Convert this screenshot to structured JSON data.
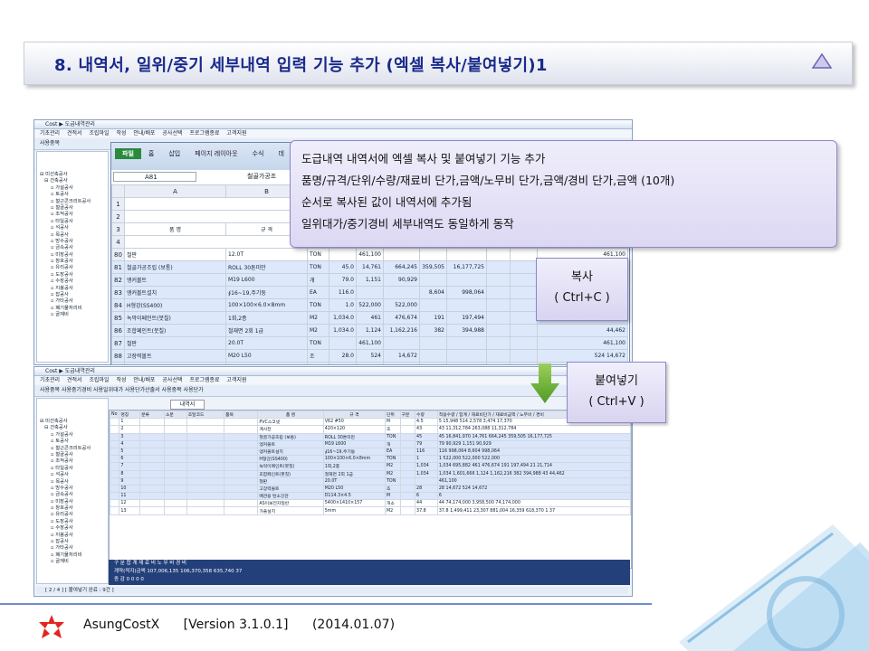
{
  "banner": {
    "title": "8. 내역서, 일위/중기 세부내역 입력 기능 추가 (엑셀 복사/붙여넣기)1"
  },
  "callout": {
    "lines": [
      "도급내역 내역서에 엑셀 복사 및 붙여넣기 기능 추가",
      "품명/규격/단위/수량/재료비 단가,금액/노무비 단가,금액/경비 단가,금액 (10개)",
      "순서로 복사된 값이 내역서에 추가됨",
      "일위대가/중기경비 세부내역도 동일하게 동작"
    ]
  },
  "copy_box": {
    "title": "복사",
    "shortcut": "( Ctrl+C )"
  },
  "paste_box": {
    "title": "붙여넣기",
    "shortcut": "( Ctrl+V )"
  },
  "win1": {
    "title": "Cost ▶ 도급내역관리",
    "menu": "기초관리 견적서 조립마일 작성 안내/배포 공사선택 프로그램종료 고객지원",
    "toolbar": "사용중목",
    "unit": "A81",
    "formula": "철골가공조",
    "ribbon_tabs": [
      "파일",
      "홈",
      "삽입",
      "페이지 레이아웃",
      "수식",
      "데"
    ],
    "col_a": "A",
    "col_b": "B",
    "header_name": "품       명",
    "header_spec": "규       격",
    "tree": [
      "미선축공사",
      "건축공사",
      "가설공사",
      "토공사",
      "철근콘크리트공사",
      "철골공사",
      "조적공사",
      "타일공사",
      "석공사",
      "목공사",
      "방수공사",
      "금속공사",
      "미장공사",
      "창호공사",
      "유리공사",
      "도장공사",
      "수장공사",
      "지붕공사",
      "잡공사",
      "가타공사",
      "폐기물처리비",
      "골재비"
    ],
    "rows": [
      {
        "no": "80",
        "name": "철판",
        "spec": "12.0T",
        "unit": "TON",
        "c1": "",
        "c2": "461,100",
        "c3": "",
        "c4": "",
        "c5": "",
        "r": "461,100",
        "sel": false
      },
      {
        "no": "81",
        "name": "철골가공조립 (보통)",
        "spec": "ROLL 30톤미만",
        "unit": "TON",
        "c1": "45.0",
        "c2": "14,761",
        "c3": "664,245",
        "c4": "359,505",
        "c5": "16,177,725",
        "r": "374,",
        "sel": true
      },
      {
        "no": "82",
        "name": "앵커볼트",
        "spec": "M19  L600",
        "unit": "개",
        "c1": "79.0",
        "c2": "1,151",
        "c3": "90,929",
        "c4": "",
        "c5": "",
        "r": "1,",
        "sel": true
      },
      {
        "no": "83",
        "name": "앵커볼트설치",
        "spec": "∮16~19,주기둥",
        "unit": "EA",
        "c1": "116.0",
        "c2": "",
        "c3": "",
        "c4": "8,604",
        "c5": "998,064",
        "r": "8,",
        "sel": true
      },
      {
        "no": "84",
        "name": "H형강(SS400)",
        "spec": "100×100×6.0×8mm",
        "unit": "TON",
        "c1": "1.0",
        "c2": "522,000",
        "c3": "522,000",
        "c4": "",
        "c5": "",
        "r": "522,",
        "sel": true
      },
      {
        "no": "85",
        "name": "녹막이페인트(붓칠)",
        "spec": "1회,2종",
        "unit": "M2",
        "c1": "1,034.0",
        "c2": "461",
        "c3": "476,674",
        "c4": "191",
        "c5": "197,494",
        "r": "21,714",
        "sel": true
      },
      {
        "no": "86",
        "name": "조합페인트(붓칠)",
        "spec": "철재면 2회 1급",
        "unit": "M2",
        "c1": "1,034.0",
        "c2": "1,124",
        "c3": "1,162,216",
        "c4": "382",
        "c5": "394,988",
        "r": "44,462",
        "sel": true
      },
      {
        "no": "87",
        "name": "철판",
        "spec": "20.0T",
        "unit": "TON",
        "c1": "",
        "c2": "461,100",
        "c3": "",
        "c4": "",
        "c5": "",
        "r": "461,100",
        "sel": true
      },
      {
        "no": "88",
        "name": "고장력볼트",
        "spec": "M20  L50",
        "unit": "조",
        "c1": "28.0",
        "c2": "524",
        "c3": "14,672",
        "c4": "",
        "c5": "",
        "r": "524  14,672",
        "sel": true
      },
      {
        "no": "89",
        "name": "배관용 탄소강관",
        "spec": "D114.3×4.5",
        "unit": "M",
        "c1": "6.0",
        "c2": "",
        "c3": "",
        "c4": "",
        "c5": "",
        "r": "",
        "sel": true
      },
      {
        "no": "90",
        "name": "H형강(SS400)",
        "spec": "300×150×6.5×9mm",
        "unit": "TON",
        "c1": "2.0",
        "c2": "522,000",
        "c3": "1,044,000",
        "c4": "",
        "c5": "",
        "r": "522,000  1,044,000",
        "sel": false
      }
    ]
  },
  "win2": {
    "title": "Cost ▶ 도급내역관리",
    "menu": "기초관리 견적서 조립마일 작성 안내/배포 공사선택 프로그램종료 고객지원",
    "toolbar": "사용중목   사용중기경비   사용일위대가   사용단가산출서   사용중목   사용단가",
    "tab_label": "내역서",
    "headers": [
      "No",
      "명칭",
      "분류",
      "소분",
      "조달코드",
      "품목",
      "품  명",
      "규  격",
      "단위",
      "구분",
      "수량",
      "적용수량",
      "합  계",
      "재료비단가",
      "재료비금액",
      "노무비단가",
      "노무비금액",
      "경비단가",
      "경비금액",
      "비고"
    ],
    "rows": [
      {
        "n": "1",
        "name": "PVC스코넷",
        "spec": "V62    #50",
        "unit": "M",
        "q": "4.5",
        "amt": "5   15,948   514   2,578   3,474   17,370",
        "hl": false
      },
      {
        "n": "2",
        "name": "계사천",
        "spec": "420×120",
        "unit": "조",
        "q": "43",
        "amt": "43  11,312,784   263,088  11,312,784",
        "hl": false
      },
      {
        "n": "3",
        "name": "철골가공조립 (보통)",
        "spec": "ROLL 30톤미만",
        "unit": "TON",
        "q": "45",
        "amt": "45  16,841,970   14,761   664,245   359,505  16,177,725",
        "hl": true
      },
      {
        "n": "4",
        "name": "앵커볼트",
        "spec": "M19 L600",
        "unit": "개",
        "q": "79",
        "amt": "79   90,929   1,151   90,929",
        "hl": true
      },
      {
        "n": "5",
        "name": "앵커볼트설치",
        "spec": "∮16~19,주기둥",
        "unit": "EA",
        "q": "116",
        "amt": "116   998,064   8,604   998,064",
        "hl": true
      },
      {
        "n": "6",
        "name": "H형강(SS400)",
        "spec": "100×100×6.0×8mm",
        "unit": "TON",
        "q": "1",
        "amt": "1   522,000   522,000   522,000",
        "hl": true
      },
      {
        "n": "7",
        "name": "녹막이페인트(붓칠)",
        "spec": "1회,2종",
        "unit": "M2",
        "q": "1,034",
        "amt": "1,034   695,882   461   476,674   191   197,494   21   21,714",
        "hl": true
      },
      {
        "n": "8",
        "name": "조합페인트(붓칠)",
        "spec": "철재면 2회 1급",
        "unit": "M2",
        "q": "1,034",
        "amt": "1,034  1,601,666   1,124  1,162,216   382   394,988   43   44,462",
        "hl": true
      },
      {
        "n": "9",
        "name": "철판",
        "spec": "20.0T",
        "unit": "TON",
        "q": "",
        "amt": "461,100",
        "hl": true
      },
      {
        "n": "10",
        "name": "고장력볼트",
        "spec": "M20  L50",
        "unit": "조",
        "q": "28",
        "amt": "28   14,672   524   14,672",
        "hl": true
      },
      {
        "n": "11",
        "name": "배관용 탄소강관",
        "spec": "D114.3×4.5",
        "unit": "M",
        "q": "6",
        "amt": "6",
        "hl": true
      },
      {
        "n": "12",
        "name": "AS이보전자일반",
        "spec": "5400×1410×157",
        "unit": "개소",
        "q": "44",
        "amt": "44  74,174,000   3,958,500  74,174,000",
        "hl": false
      },
      {
        "n": "13",
        "name": "가줄설치",
        "spec": "5mm",
        "unit": "M2",
        "q": "37.8",
        "amt": "37.8   1,499,411   23,307   881,004   16,359   618,370   1   37",
        "hl": false
      }
    ],
    "totals": {
      "labels": "구  분      합  계      재 료 비      노 무 비      경  비",
      "row1": "계약(적지)금액   107,006,135   106,370,358   635,740   37",
      "row2": "증     감   0   0   0   0"
    },
    "status": "[ 2 / 4 ]    [ 붙여넣기 완료 : 9건 ]"
  },
  "footer": {
    "app": "AsungCostX",
    "version": "[Version 3.1.0.1]",
    "date": "(2014.01.07)"
  }
}
